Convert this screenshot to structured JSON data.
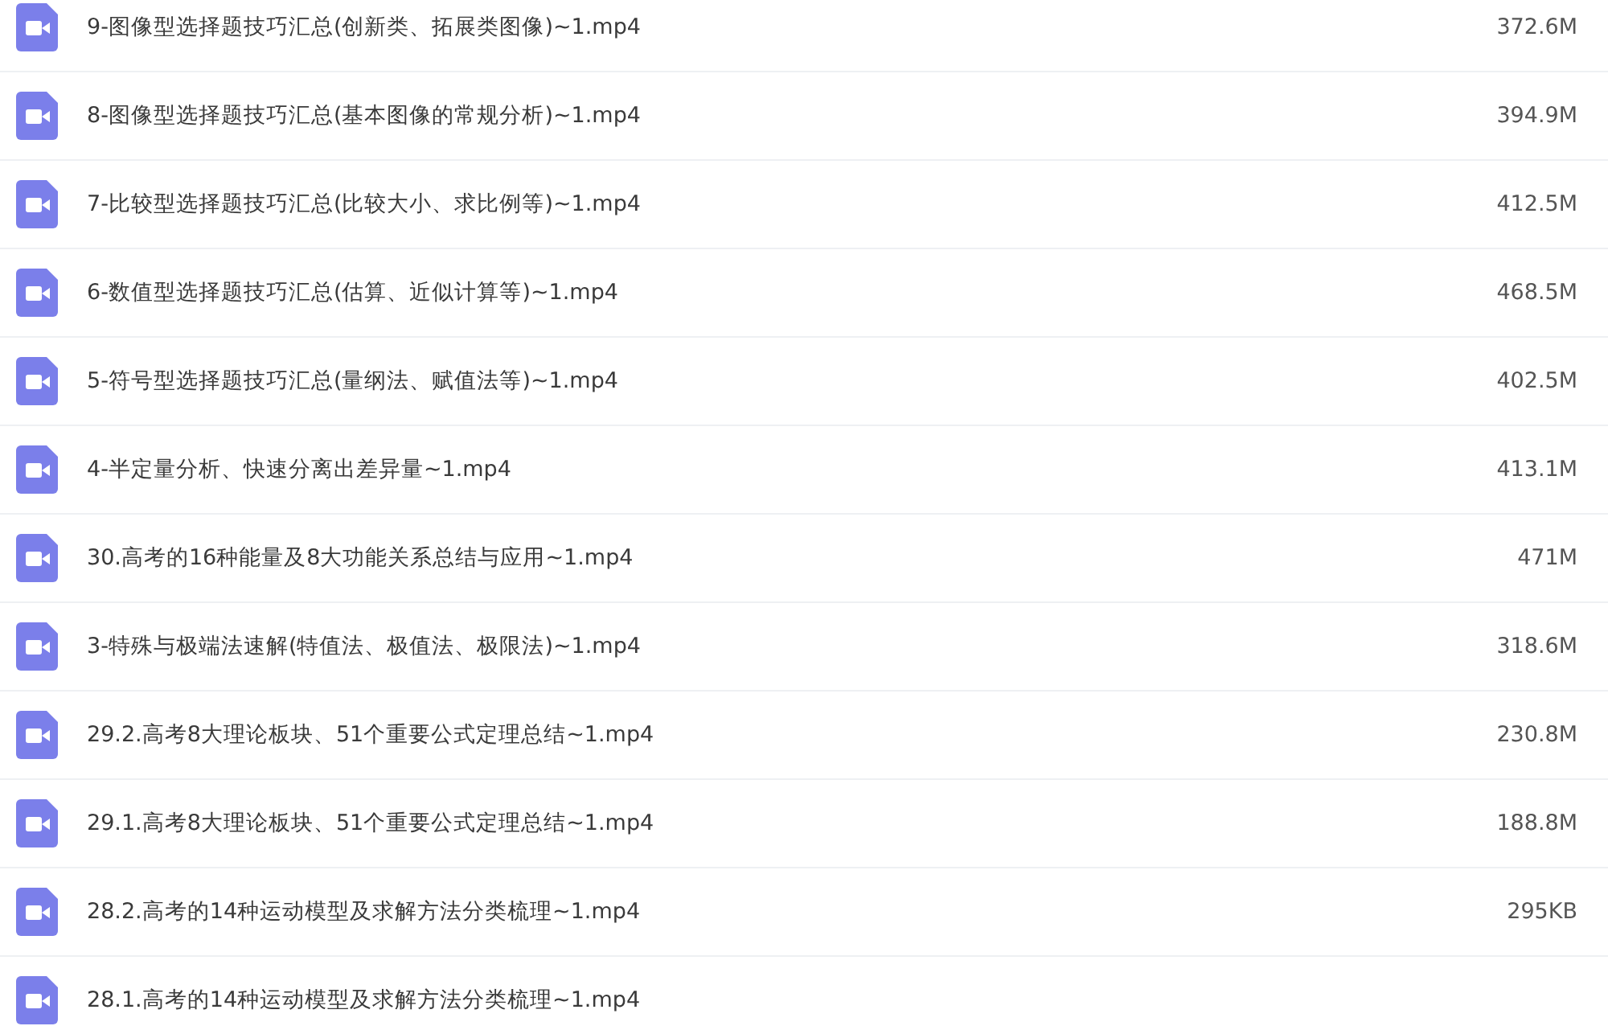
{
  "files": [
    {
      "name": "9-图像型选择题技巧汇总(创新类、拓展类图像)~1.mp4",
      "size": "372.6M"
    },
    {
      "name": "8-图像型选择题技巧汇总(基本图像的常规分析)~1.mp4",
      "size": "394.9M"
    },
    {
      "name": "7-比较型选择题技巧汇总(比较大小、求比例等)~1.mp4",
      "size": "412.5M"
    },
    {
      "name": "6-数值型选择题技巧汇总(估算、近似计算等)~1.mp4",
      "size": "468.5M"
    },
    {
      "name": "5-符号型选择题技巧汇总(量纲法、赋值法等)~1.mp4",
      "size": "402.5M"
    },
    {
      "name": "4-半定量分析、快速分离出差异量~1.mp4",
      "size": "413.1M"
    },
    {
      "name": "30.高考的16种能量及8大功能关系总结与应用~1.mp4",
      "size": "471M"
    },
    {
      "name": "3-特殊与极端法速解(特值法、极值法、极限法)~1.mp4",
      "size": "318.6M"
    },
    {
      "name": "29.2.高考8大理论板块、51个重要公式定理总结~1.mp4",
      "size": "230.8M"
    },
    {
      "name": "29.1.高考8大理论板块、51个重要公式定理总结~1.mp4",
      "size": "188.8M"
    },
    {
      "name": "28.2.高考的14种运动模型及求解方法分类梳理~1.mp4",
      "size": "295KB"
    },
    {
      "name": "28.1.高考的14种运动模型及求解方法分类梳理~1.mp4"
    }
  ]
}
